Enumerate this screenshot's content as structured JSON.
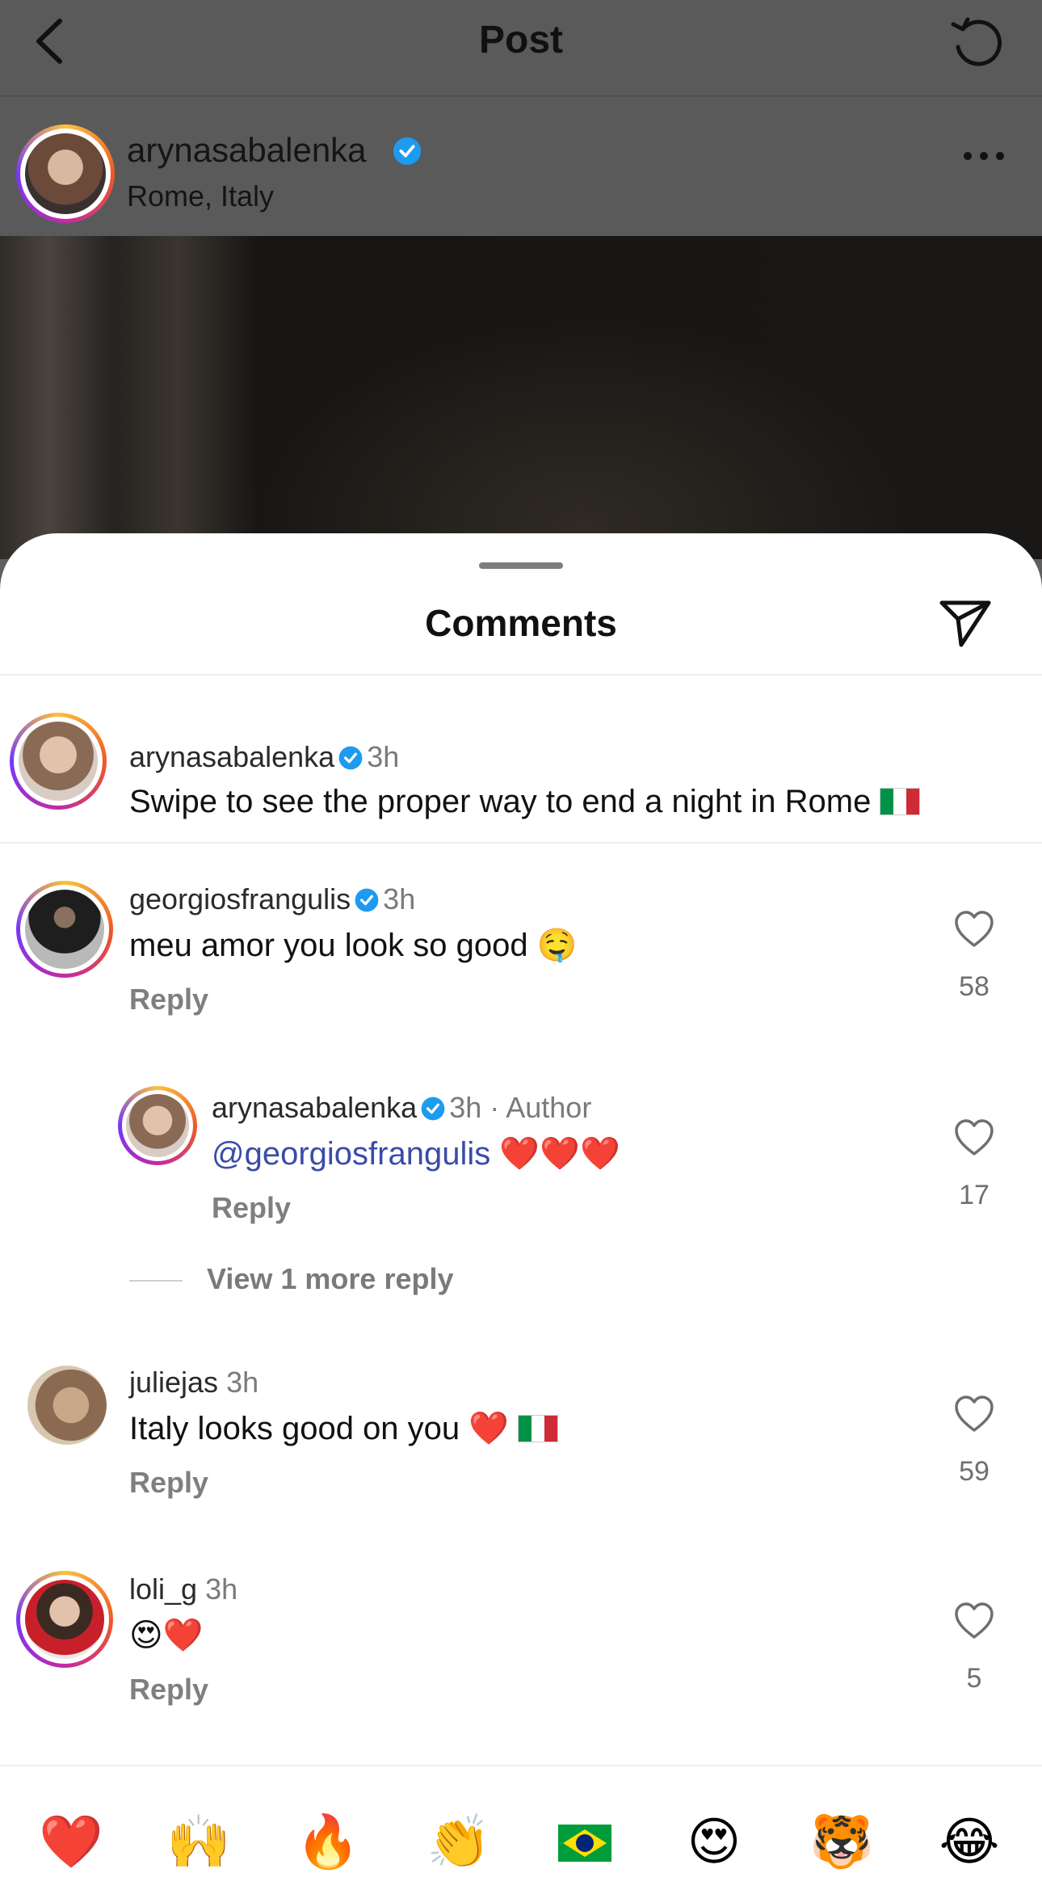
{
  "topbar": {
    "title": "Post"
  },
  "post_header": {
    "username": "arynasabalenka",
    "location": "Rome, Italy"
  },
  "comments_sheet": {
    "title": "Comments"
  },
  "caption": {
    "username": "arynasabalenka",
    "time": "3h",
    "text": "Swipe to see the proper way to end a night in Rome"
  },
  "comments": [
    {
      "username": "georgiosfrangulis",
      "time": "3h",
      "text": "meu amor you look so good",
      "emoji": "🤤",
      "reply": "Reply",
      "likes": "58"
    },
    {
      "username": "juliejas",
      "time": "3h",
      "text": "Italy looks good on you",
      "emoji": "❤️",
      "reply": "Reply",
      "likes": "59"
    },
    {
      "username": "loli_g",
      "time": "3h",
      "text": "",
      "emoji": "😍❤️",
      "reply": "Reply",
      "likes": "5"
    }
  ],
  "reply": {
    "username": "arynasabalenka",
    "time": "3h · Author",
    "mention": "@georgiosfrangulis",
    "emoji": "❤️❤️❤️",
    "reply": "Reply",
    "likes": "17"
  },
  "view_more": "View 1 more reply",
  "reactions": [
    "❤️",
    "🙌",
    "🔥",
    "👏",
    "brazil-flag",
    "😍",
    "🐯",
    "😂"
  ],
  "colors": {
    "verified": "#1d9bf0",
    "mention": "#3a4ca8",
    "ring_start": "#f9c23c",
    "ring_end": "#c32aa3"
  }
}
